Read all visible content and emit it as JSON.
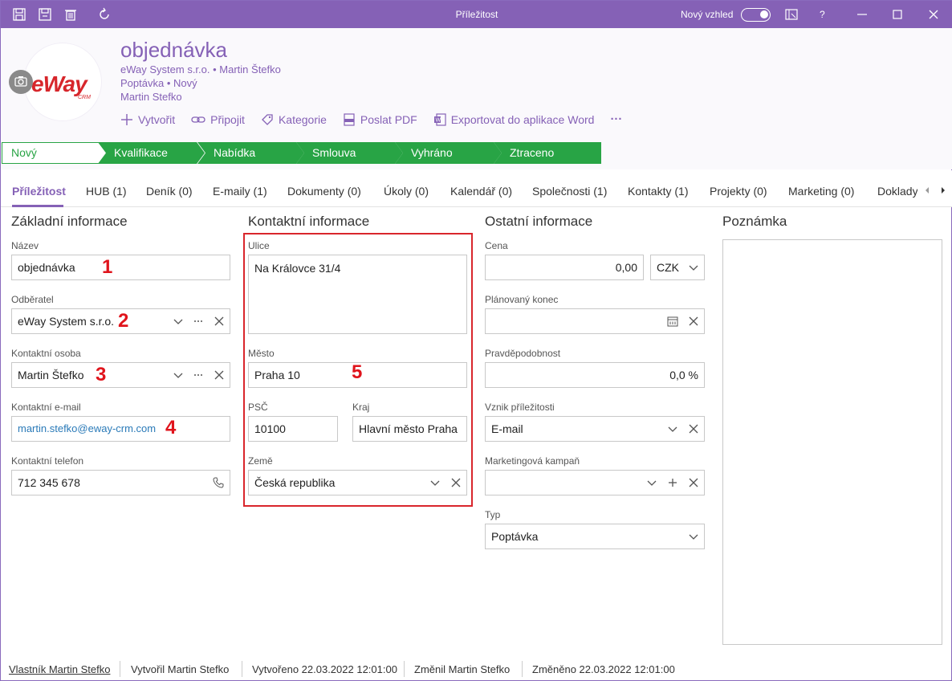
{
  "window": {
    "title": "Příležitost",
    "new_look_label": "Nový vzhled",
    "help_label": "?"
  },
  "header": {
    "title": "objednávka",
    "line1_company": "eWay System s.r.o.",
    "line1_contact": "Martin Štefko",
    "line2_type": "Poptávka",
    "line2_status": "Nový",
    "line3_owner": "Martin Stefko",
    "logo_text": "eWay",
    "logo_sub": "CRM",
    "actions": {
      "create": "Vytvořit",
      "attach": "Připojit",
      "category": "Kategorie",
      "send_pdf": "Poslat PDF",
      "export_word": "Exportovat do aplikace Word",
      "more": "···"
    }
  },
  "stages": [
    {
      "label": "Nový",
      "active": true
    },
    {
      "label": "Kvalifikace"
    },
    {
      "label": "Nabídka"
    },
    {
      "label": "Smlouva"
    },
    {
      "label": "Vyhráno"
    },
    {
      "label": "Ztraceno"
    }
  ],
  "tabs": [
    "Příležitost",
    "HUB (1)",
    "Deník (0)",
    "E-maily (1)",
    "Dokumenty (0)",
    "Úkoly (0)",
    "Kalendář (0)",
    "Společnosti (1)",
    "Kontakty (1)",
    "Projekty (0)",
    "Marketing (0)",
    "Doklady"
  ],
  "basic": {
    "title": "Základní informace",
    "name_label": "Název",
    "name_value": "objednávka",
    "customer_label": "Odběratel",
    "customer_value": "eWay System s.r.o.",
    "contact_label": "Kontaktní osoba",
    "contact_value": "Martin Štefko",
    "email_label": "Kontaktní e-mail",
    "email_value": "martin.stefko@eway-crm.com",
    "phone_label": "Kontaktní telefon",
    "phone_value": "712 345 678"
  },
  "contact_info": {
    "title": "Kontaktní informace",
    "street_label": "Ulice",
    "street_value": "Na Královce 31/4",
    "city_label": "Město",
    "city_value": "Praha 10",
    "zip_label": "PSČ",
    "zip_value": "10100",
    "region_label": "Kraj",
    "region_value": "Hlavní město Praha",
    "country_label": "Země",
    "country_value": "Česká republika"
  },
  "other": {
    "title": "Ostatní informace",
    "price_label": "Cena",
    "price_value": "0,00",
    "currency_value": "CZK",
    "end_label": "Plánovaný konec",
    "end_value": "",
    "prob_label": "Pravděpodobnost",
    "prob_value": "0,0 %",
    "origin_label": "Vznik příležitosti",
    "origin_value": "E-mail",
    "campaign_label": "Marketingová kampaň",
    "campaign_value": "",
    "type_label": "Typ",
    "type_value": "Poptávka"
  },
  "note": {
    "title": "Poznámka"
  },
  "annotations": [
    "1",
    "2",
    "3",
    "4",
    "5"
  ],
  "footer": {
    "owner": "Vlastník Martin Stefko",
    "created_by": "Vytvořil Martin Stefko",
    "created_at": "Vytvořeno 22.03.2022 12:01:00",
    "changed_by": "Změnil Martin Stefko",
    "changed_at": "Změněno 22.03.2022 12:01:00"
  },
  "colors": {
    "accent": "#8561b6",
    "stage_green": "#28a445",
    "annotation_red": "#e0141c"
  }
}
